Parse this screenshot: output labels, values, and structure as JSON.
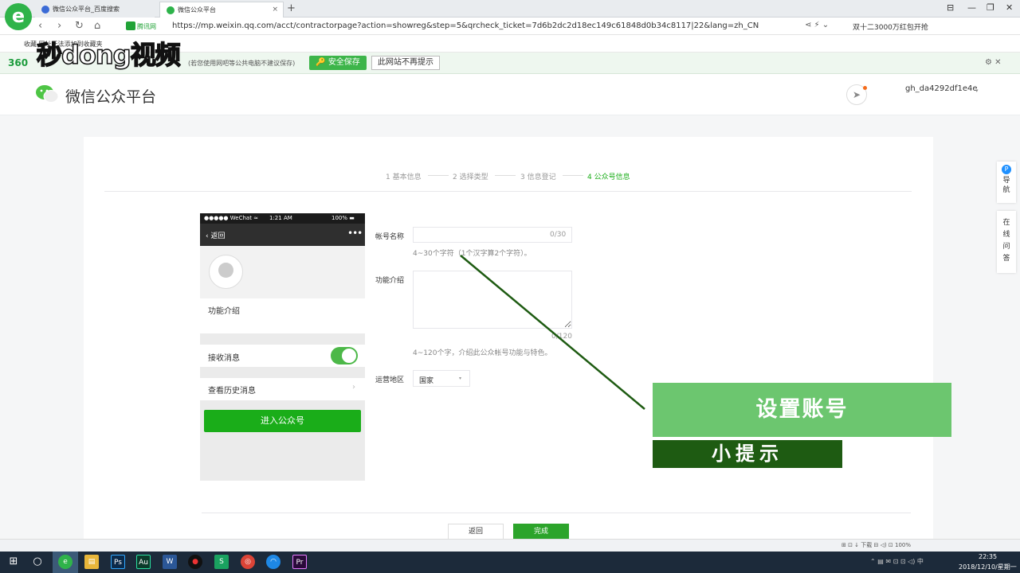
{
  "browser": {
    "logo": "e",
    "tabs": [
      {
        "label": "微信公众平台_百度搜索",
        "active": false,
        "icon": "paw-icon"
      },
      {
        "label": "微信公众平台",
        "active": true,
        "icon": "wechat-icon"
      }
    ],
    "close_glyph": "×",
    "new_tab": "+",
    "window_buttons": [
      "⊟",
      "—",
      "❐",
      "✕"
    ],
    "nav": [
      "‹",
      "›",
      "↻",
      "⌂"
    ],
    "secure_label": "腾讯网",
    "url": "https://mp.weixin.qq.com/acct/contractorpage?action=showreg&step=5&qrcheck_ticket=7d6b2dc2d18ec149c61848d0b34c8117|22&lang=zh_CN",
    "addr_right": "⋖ ⚡ ⌄",
    "ad_text": "双十二3000万红包开抢",
    "fav_label": "收藏  网址无法添加到收藏夹",
    "notice_brand": "360",
    "notice_text": "(若您使用网吧等公共电脑不建议保存)",
    "save_label": "安全保存",
    "no_remind_label": "此网站不再提示",
    "notice_icons": "⚙    ✕"
  },
  "watermark": "秒dong视频",
  "header": {
    "title": "微信公众平台",
    "notify_glyph": "➤",
    "account_id": "gh_da4292df1e4e",
    "caret": "▾"
  },
  "steps": [
    {
      "label": "1 基本信息",
      "active": false
    },
    {
      "label": "2 选择类型",
      "active": false
    },
    {
      "label": "3 信息登记",
      "active": false
    },
    {
      "label": "4 公众号信息",
      "active": true
    }
  ],
  "phone": {
    "status_left": "●●●●● WeChat ≈",
    "status_time": "1:21 AM",
    "status_right": "100% ▬",
    "back": "‹ 返回",
    "more": "•••",
    "intro": "功能介绍",
    "receive": "接收消息",
    "receive_on": true,
    "history": "查看历史消息",
    "history_arrow": "›",
    "enter": "进入公众号"
  },
  "form": {
    "name_label": "帐号名称",
    "name_value": "",
    "name_counter": "0/30",
    "name_tip": "4~30个字符（1个汉字算2个字符）。",
    "intro_label": "功能介绍",
    "intro_value": "",
    "intro_counter": "0/120",
    "intro_tip": "4~120个字，介绍此公众帐号功能与特色。",
    "region_label": "运营地区",
    "region_value": "国家",
    "region_caret": "▾",
    "back_label": "返回",
    "done_label": "完成"
  },
  "overlay": {
    "main": "设置账号",
    "sub": "小提示"
  },
  "side": {
    "nav_badge": "P",
    "nav_label": "导航",
    "help_label": "在线问答"
  },
  "statusbar": "⊞   ⊡   ↓ 下载   ⊟   ◁)   ⊡   100%",
  "taskbar": {
    "start": "⊞",
    "search": "○",
    "apps": [
      "e",
      "▤",
      "Ps",
      "Au",
      "W",
      "●",
      "S",
      "◎",
      "◠",
      "Pr"
    ],
    "tray": "⌃  ▤  ✉  ⊡  ⊡  ◁)  中",
    "time": "22:35",
    "date": "2018/12/10/星期一"
  },
  "colors": {
    "accent": "#1aad19",
    "banner_light": "#6cc66f",
    "banner_dark": "#1e5b12"
  }
}
